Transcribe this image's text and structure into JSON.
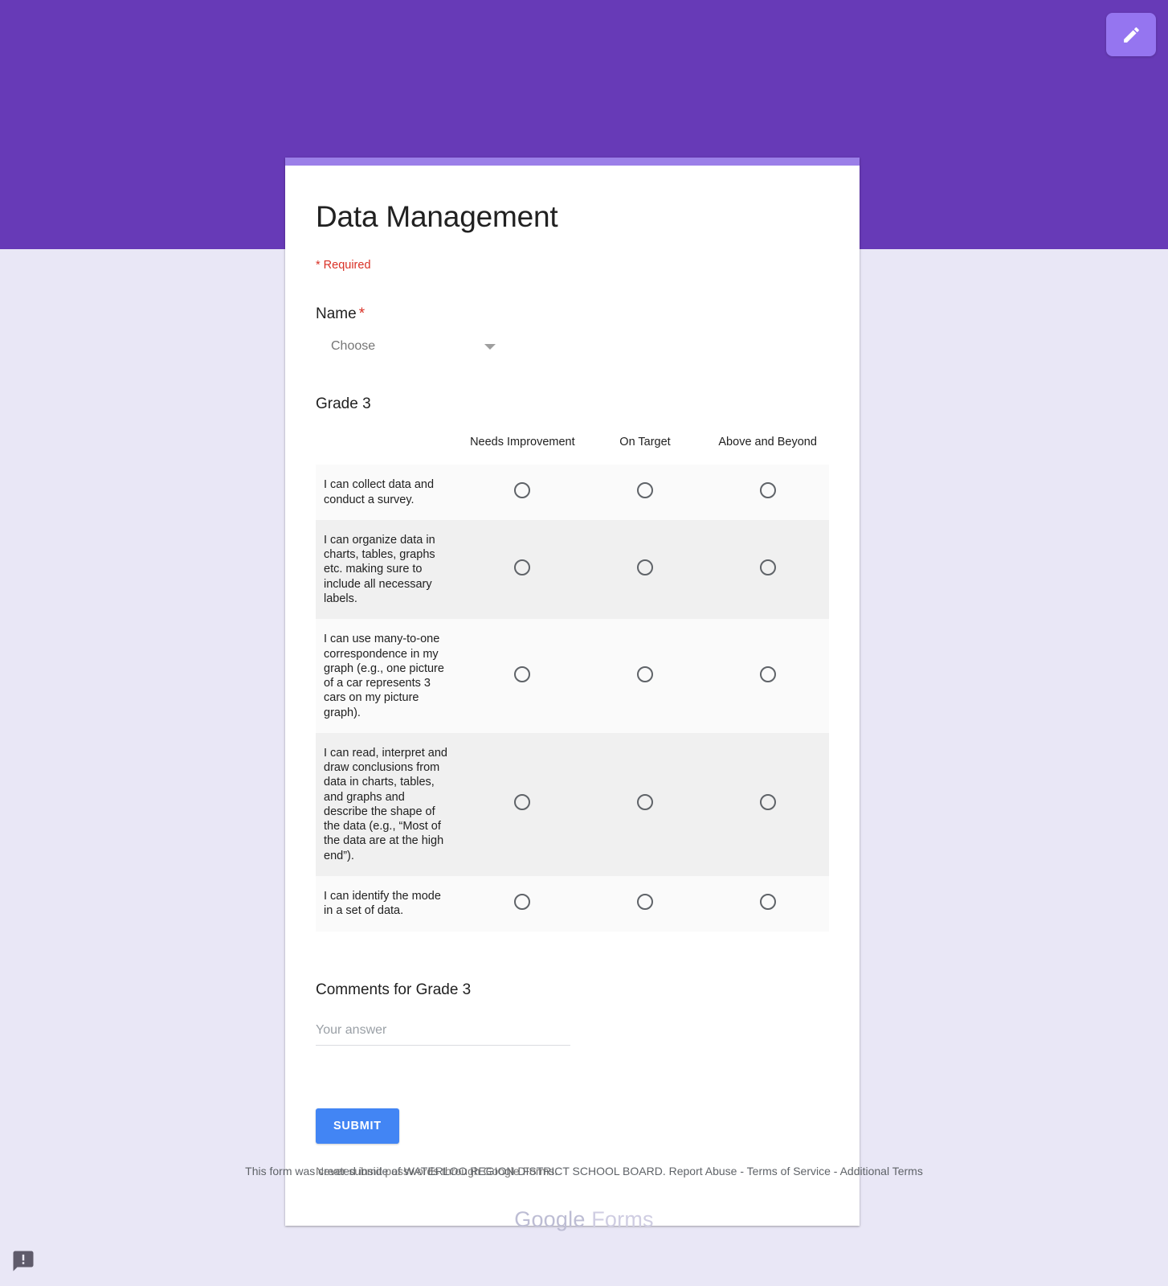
{
  "theme": {
    "banner_color": "#673AB7",
    "card_accent_color": "#9B7FE8",
    "page_background": "#E9E7F6",
    "submit_color": "#4285F4",
    "required_color": "#D93025",
    "fab_color": "#9575F0"
  },
  "header": {
    "edit_button_label": "Edit this form",
    "edit_icon": "pencil-icon"
  },
  "form": {
    "title": "Data Management",
    "required_note": "* Required"
  },
  "name_field": {
    "label": "Name",
    "required_marker": "*",
    "selected_value": "Choose",
    "caret_icon": "chevron-down-icon"
  },
  "grid": {
    "title": "Grade 3",
    "columns": [
      "Needs Improvement",
      "On Target",
      "Above and Beyond"
    ],
    "rows": [
      "I can collect data and conduct a survey.",
      "I can organize data in charts, tables, graphs etc. making sure to include all necessary labels.",
      "I can use many-to-one correspondence in my graph (e.g., one picture of a car represents 3 cars on my picture graph).",
      "I can read, interpret and draw conclusions from data in charts, tables, and graphs and describe the shape of the data (e.g., “Most of the data are at the high end”).",
      "I can identify the mode in a set of data."
    ],
    "selected": [
      null,
      null,
      null,
      null,
      null
    ]
  },
  "comments": {
    "title": "Comments for Grade 3",
    "placeholder": "Your answer",
    "value": ""
  },
  "actions": {
    "submit_label": "SUBMIT",
    "never_note": "Never submit passwords through Google Forms."
  },
  "footer": {
    "created_inside_text": "This form was created inside of WATERLOO REGION DISTRICT SCHOOL BOARD.",
    "report_abuse": "Report Abuse",
    "separator": " - ",
    "terms_of_service": "Terms of Service",
    "additional_terms": "Additional Terms",
    "logo_part1": "Google",
    "logo_part2": " Forms",
    "feedback_icon": "feedback-report-icon"
  }
}
